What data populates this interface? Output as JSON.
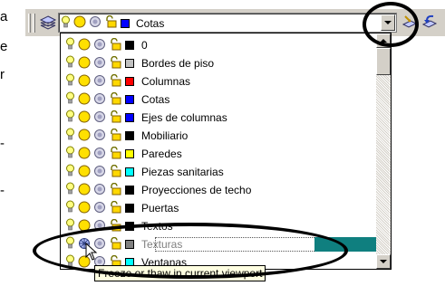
{
  "document_fragment": {
    "lines": [
      "a",
      "e",
      "r",
      "",
      "-",
      "-"
    ]
  },
  "toolbar": {
    "layer_manager_icon": "layers-icon",
    "current_layer": {
      "name": "Cotas",
      "color": "#0000ff"
    },
    "make_current_icon": "make-current-icon",
    "layer_previous_icon": "layer-previous-icon"
  },
  "layers": [
    {
      "name": "0",
      "color": "#000000",
      "frozen": false
    },
    {
      "name": "Bordes de piso",
      "color": "#c0c0c0",
      "frozen": false
    },
    {
      "name": "Columnas",
      "color": "#ff0000",
      "frozen": false
    },
    {
      "name": "Cotas",
      "color": "#0000ff",
      "frozen": false
    },
    {
      "name": "Ejes de columnas",
      "color": "#0000ff",
      "frozen": false
    },
    {
      "name": "Mobiliario",
      "color": "#000000",
      "frozen": false
    },
    {
      "name": "Paredes",
      "color": "#ffff00",
      "frozen": false
    },
    {
      "name": "Piezas sanitarias",
      "color": "#00ffff",
      "frozen": false
    },
    {
      "name": "Proyecciones de techo",
      "color": "#000000",
      "frozen": false
    },
    {
      "name": "Puertas",
      "color": "#000000",
      "frozen": false
    },
    {
      "name": "Textos",
      "color": "#000000",
      "frozen": false
    },
    {
      "name": "Texturas",
      "color": "#808080",
      "frozen": true,
      "selected": true
    },
    {
      "name": "Ventanas",
      "color": "#00ffff",
      "frozen": false
    }
  ],
  "tooltip": {
    "text": "Freeze or thaw in current viewport"
  },
  "colors": {
    "selection": "#0f7f7f",
    "tooltip_bg": "#ffffe1",
    "face": "#d4d0c8"
  }
}
